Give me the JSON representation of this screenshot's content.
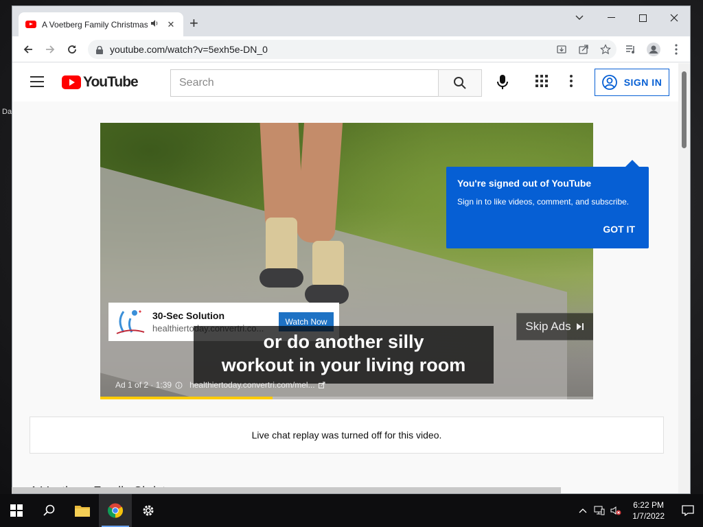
{
  "browser": {
    "tab_title": "A Voetberg Family Christmas",
    "url": "youtube.com/watch?v=5exh5e-DN_0"
  },
  "youtube": {
    "logo_text": "YouTube",
    "search_placeholder": "Search",
    "sign_in_label": "SIGN IN",
    "popup": {
      "title": "You're signed out of YouTube",
      "body": "Sign in to like videos, comment, and subscribe.",
      "button": "GOT IT"
    },
    "ad": {
      "title": "30-Sec Solution",
      "url": "healthiertoday.convertri.co...",
      "button": "Watch Now",
      "skip_label": "Skip Ads",
      "counter": "Ad 1 of 2 · 1:39",
      "display_url": "healthiertoday.convertri.com/mel...",
      "progress_fraction": 0.35
    },
    "captions": [
      "or do another silly",
      "workout in your living room"
    ],
    "chat_notice": "Live chat replay was turned off for this video.",
    "video_title": "A Voetberg Family Christmas"
  },
  "desktop": {
    "label": "Da"
  },
  "taskbar": {
    "time": "6:22 PM",
    "date": "1/7/2022"
  },
  "colors": {
    "yt_red": "#ff0000",
    "brand_blue": "#065fd4",
    "ad_progress": "#ffcc00"
  }
}
